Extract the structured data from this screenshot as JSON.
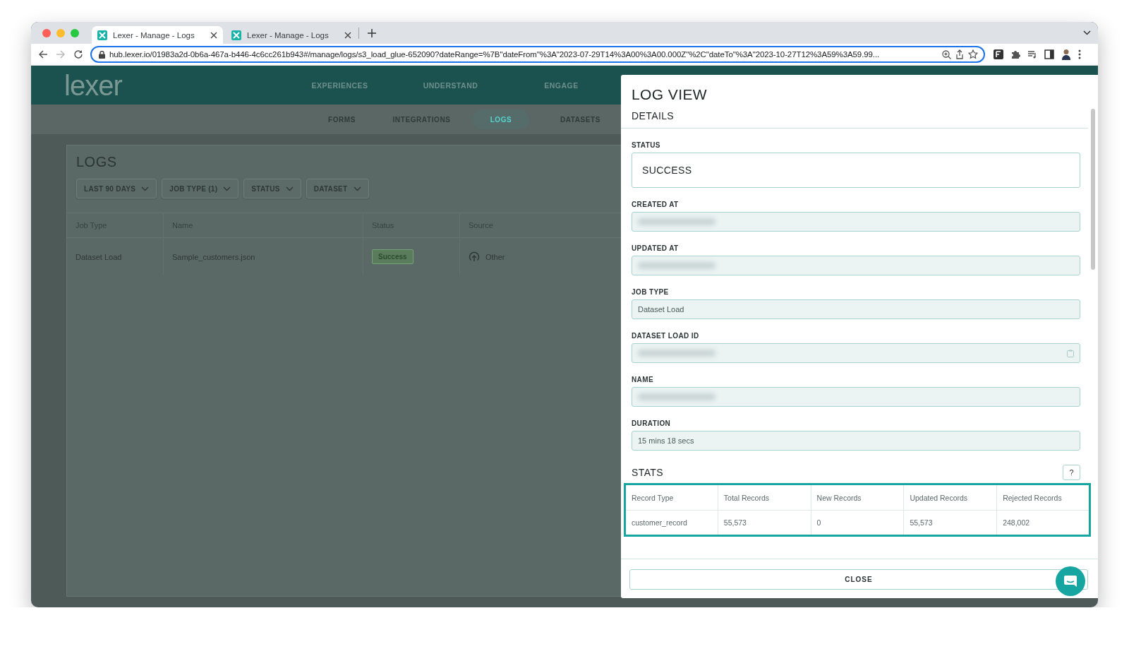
{
  "browser": {
    "tabs": [
      {
        "title": "Lexer - Manage - Logs",
        "selected": true
      },
      {
        "title": "Lexer - Manage - Logs",
        "selected": false
      }
    ],
    "url": "hub.lexer.io/01983a2d-0b6a-467a-b446-4c6cc261b943#/manage/logs/s3_load_glue-652090?dateRange=%7B\"dateFrom\"%3A\"2023-07-29T14%3A00%3A00.000Z\"%2C\"dateTo\"%3A\"2023-10-27T12%3A59%3A59.99..."
  },
  "app": {
    "logo": "lexer",
    "nav": [
      {
        "label": "EXPERIENCES"
      },
      {
        "label": "UNDERSTAND"
      },
      {
        "label": "ENGAGE"
      }
    ],
    "subnav": [
      {
        "label": "FORMS",
        "selected": false
      },
      {
        "label": "INTEGRATIONS",
        "selected": false
      },
      {
        "label": "LOGS",
        "selected": true
      },
      {
        "label": "DATASETS",
        "selected": false
      }
    ]
  },
  "logs": {
    "title": "LOGS",
    "filters": [
      "LAST 90 DAYS",
      "JOB TYPE (1)",
      "STATUS",
      "DATASET"
    ],
    "columns": [
      "Job Type",
      "Name",
      "Status",
      "Source"
    ],
    "rows": [
      {
        "job_type": "Dataset Load",
        "name": "Sample_customers.json",
        "status": "Success",
        "source": "Other"
      }
    ]
  },
  "log_view": {
    "title": "LOG VIEW",
    "section": "DETAILS",
    "fields": [
      {
        "label": "STATUS",
        "kind": "status",
        "value": "SUCCESS"
      },
      {
        "label": "CREATED AT",
        "kind": "redacted"
      },
      {
        "label": "UPDATED AT",
        "kind": "redacted"
      },
      {
        "label": "JOB TYPE",
        "kind": "text",
        "value": "Dataset Load"
      },
      {
        "label": "DATASET LOAD ID",
        "kind": "redacted",
        "copyable": true
      },
      {
        "label": "NAME",
        "kind": "redacted"
      },
      {
        "label": "DURATION",
        "kind": "text",
        "value": "15 mins 18 secs"
      }
    ],
    "stats": {
      "title": "STATS",
      "help": "?",
      "columns": [
        "Record Type",
        "Total Records",
        "New Records",
        "Updated Records",
        "Rejected Records"
      ],
      "rows": [
        [
          "customer_record",
          "55,573",
          "0",
          "55,573",
          "248,002"
        ]
      ]
    },
    "close": "CLOSE"
  }
}
